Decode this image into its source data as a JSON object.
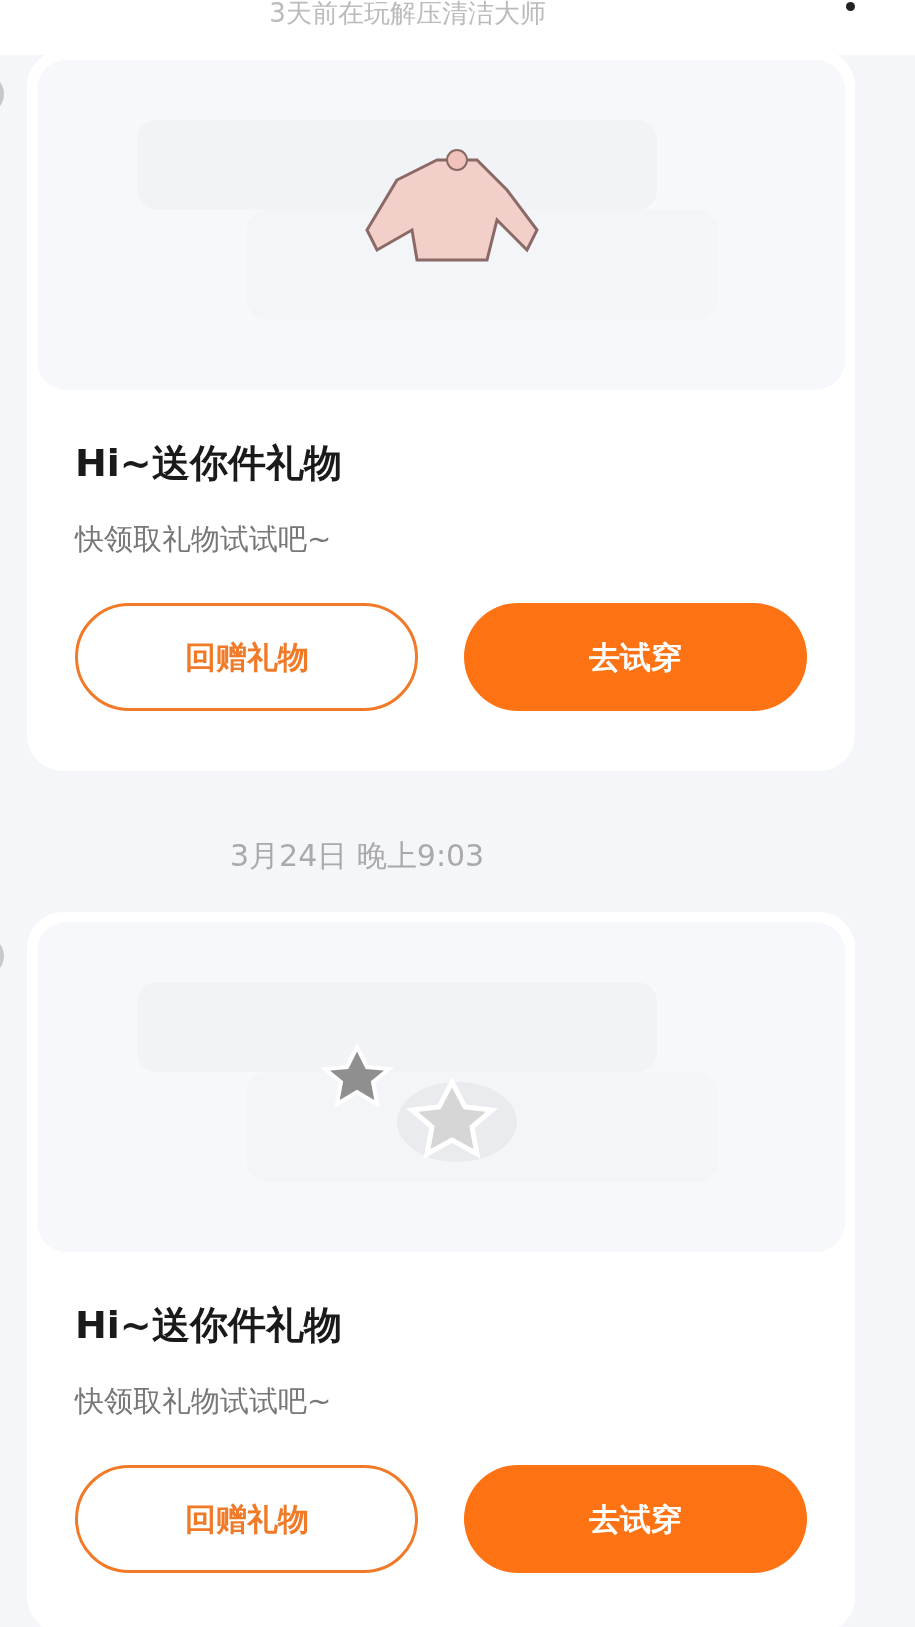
{
  "header": {
    "subtitle": "3天前在玩解压清洁大师"
  },
  "messages": [
    {
      "kind": "gift",
      "title": "Hi~送你件礼物",
      "text": "快领取礼物试试吧~",
      "buttons": [
        {
          "label": "回赠礼物",
          "kind": "outline"
        },
        {
          "label": "去试穿",
          "kind": "filled"
        }
      ]
    },
    {
      "kind": "time",
      "label": "3月24日 晚上9:03"
    },
    {
      "kind": "gift",
      "title": "Hi~送你件礼物",
      "text": "快领取礼物试试吧~",
      "buttons": [
        {
          "label": "回赠礼物",
          "kind": "outline"
        },
        {
          "label": "去试穿",
          "kind": "filled"
        }
      ]
    }
  ]
}
